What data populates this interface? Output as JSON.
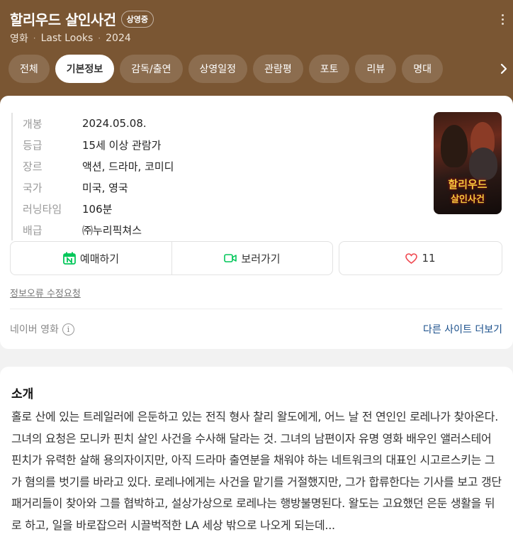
{
  "header": {
    "title": "할리우드 살인사건",
    "status_badge": "상영중",
    "meta": [
      "영화",
      "Last Looks",
      "2024"
    ],
    "menu_icon": "more-vertical-icon"
  },
  "tabs": [
    {
      "label": "전체"
    },
    {
      "label": "기본정보",
      "active": true
    },
    {
      "label": "감독/출연"
    },
    {
      "label": "상영일정"
    },
    {
      "label": "관람평"
    },
    {
      "label": "포토"
    },
    {
      "label": "리뷰"
    },
    {
      "label": "명대"
    }
  ],
  "info": [
    {
      "label": "개봉",
      "value": "2024.05.08."
    },
    {
      "label": "등급",
      "value": "15세 이상 관람가"
    },
    {
      "label": "장르",
      "value": "액션, 드라마, 코미디"
    },
    {
      "label": "국가",
      "value": "미국, 영국"
    },
    {
      "label": "러닝타임",
      "value": "106분"
    },
    {
      "label": "배급",
      "value": "㈜누리픽쳐스"
    }
  ],
  "poster": {
    "title_line1": "할리우드",
    "title_line2": "살인사건"
  },
  "actions": {
    "book_label": "예매하기",
    "watch_label": "보러가기",
    "like_count": "11",
    "colors": {
      "book": "#03c75a",
      "watch": "#03c75a",
      "like": "#f0474f"
    }
  },
  "report_link": "정보오류 수정요청",
  "source_label": "네이버 영화",
  "more_sites": "다른 사이트 더보기",
  "synopsis": {
    "title": "소개",
    "text": "홀로 산에 있는 트레일러에 은둔하고 있는 전직 형사 찰리 왈도에게, 어느 날 전 연인인 로레나가 찾아온다. 그녀의 요청은 모니카 핀치 살인 사건을 수사해 달라는 것. 그녀의 남편이자 유명 영화 배우인 앨러스테어 핀치가 유력한 살해 용의자이지만, 아직 드라마 출연분을 채워야 하는 네트워크의 대표인 시고르스키는 그가 혐의를 벗기를 바라고 있다. 로레나에게는 사건을 맡기를 거절했지만, 그가 합류한다는 기사를 보고 갱단 패거리들이 찾아와 그를 협박하고, 설상가상으로 로레나는 행방불명된다. 왈도는 고요했던 은둔 생활을 뒤로 하고, 일을 바로잡으러 시끌벅적한 LA 세상 밖으로 나오게 되는데..."
  }
}
